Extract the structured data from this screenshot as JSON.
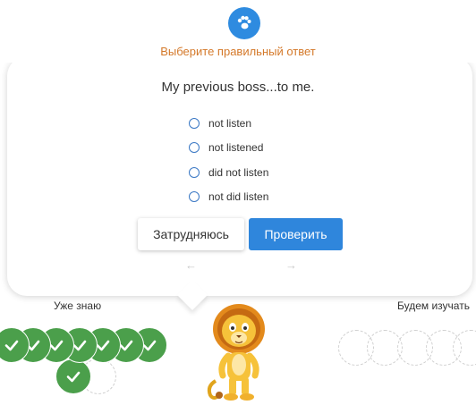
{
  "header": {
    "icon": "paw-icon",
    "instruction": "Выберите правильный ответ"
  },
  "quiz": {
    "question": "My previous boss...to me.",
    "options": [
      {
        "label": "not listen",
        "selected": false
      },
      {
        "label": "not listened",
        "selected": false
      },
      {
        "label": "did not listen",
        "selected": false
      },
      {
        "label": "not did listen",
        "selected": false
      }
    ],
    "buttons": {
      "hard": "Затрудняюсь",
      "check": "Проверить"
    },
    "nav": {
      "prev": "←",
      "next": "→"
    }
  },
  "progress": {
    "known_label": "Уже знаю",
    "study_label": "Будем изучать",
    "known_count": 7,
    "study_count": 5
  },
  "colors": {
    "accent": "#2f86dc",
    "instruction": "#d4792a",
    "known": "#4b9f4b"
  }
}
